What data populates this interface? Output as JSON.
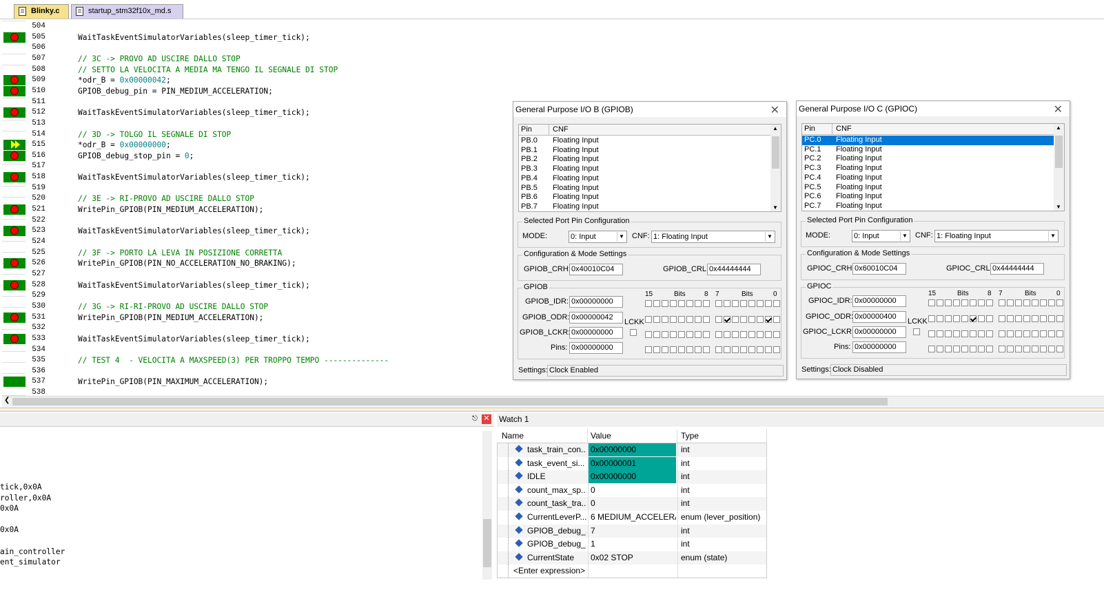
{
  "tabs": [
    {
      "label": "Blinky.c",
      "active": true
    },
    {
      "label": "startup_stm32f10x_md.s",
      "active": false
    }
  ],
  "code_lines": [
    {
      "n": "504",
      "text": "",
      "bp": false,
      "mark": false
    },
    {
      "n": "505",
      "text": "WaitTaskEventSimulatorVariables(sleep_timer_tick);",
      "bp": true,
      "mark": true
    },
    {
      "n": "506",
      "text": "",
      "bp": false,
      "mark": false
    },
    {
      "n": "507",
      "text": "// 3C -> PROVO AD USCIRE DALLO STOP",
      "bp": false,
      "mark": false,
      "comment": true
    },
    {
      "n": "508",
      "text": "// SETTO LA VELOCITA A MEDIA MA TENGO IL SEGNALE DI STOP",
      "bp": false,
      "mark": false,
      "comment": true
    },
    {
      "n": "509",
      "text": "*odr_B = 0x00000042;",
      "bp": true,
      "mark": true
    },
    {
      "n": "510",
      "text": "GPIOB_debug_pin = PIN_MEDIUM_ACCELERATION;",
      "bp": true,
      "mark": true
    },
    {
      "n": "511",
      "text": "",
      "bp": false,
      "mark": false
    },
    {
      "n": "512",
      "text": "WaitTaskEventSimulatorVariables(sleep_timer_tick);",
      "bp": true,
      "mark": true
    },
    {
      "n": "513",
      "text": "",
      "bp": false,
      "mark": false
    },
    {
      "n": "514",
      "text": "// 3D -> TOLGO IL SEGNALE DI STOP",
      "bp": false,
      "mark": false,
      "comment": true
    },
    {
      "n": "515",
      "text": "*odr_B = 0x00000000;",
      "bp": false,
      "mark": true,
      "current": true
    },
    {
      "n": "516",
      "text": "GPIOB_debug_stop_pin = 0;",
      "bp": true,
      "mark": true
    },
    {
      "n": "517",
      "text": "",
      "bp": false,
      "mark": false
    },
    {
      "n": "518",
      "text": "WaitTaskEventSimulatorVariables(sleep_timer_tick);",
      "bp": true,
      "mark": true
    },
    {
      "n": "519",
      "text": "",
      "bp": false,
      "mark": false
    },
    {
      "n": "520",
      "text": "// 3E -> RI-PROVO AD USCIRE DALLO STOP",
      "bp": false,
      "mark": false,
      "comment": true
    },
    {
      "n": "521",
      "text": "WritePin_GPIOB(PIN_MEDIUM_ACCELERATION);",
      "bp": true,
      "mark": true
    },
    {
      "n": "522",
      "text": "",
      "bp": false,
      "mark": false
    },
    {
      "n": "523",
      "text": "WaitTaskEventSimulatorVariables(sleep_timer_tick);",
      "bp": true,
      "mark": true
    },
    {
      "n": "524",
      "text": "",
      "bp": false,
      "mark": false
    },
    {
      "n": "525",
      "text": "// 3F -> PORTO LA LEVA IN POSIZIONE CORRETTA",
      "bp": false,
      "mark": false,
      "comment": true
    },
    {
      "n": "526",
      "text": "WritePin_GPIOB(PIN_NO_ACCELERATION_NO_BRAKING);",
      "bp": true,
      "mark": true
    },
    {
      "n": "527",
      "text": "",
      "bp": false,
      "mark": false
    },
    {
      "n": "528",
      "text": "WaitTaskEventSimulatorVariables(sleep_timer_tick);",
      "bp": true,
      "mark": true
    },
    {
      "n": "529",
      "text": "",
      "bp": false,
      "mark": false
    },
    {
      "n": "530",
      "text": "// 3G -> RI-RI-PROVO AD USCIRE DALLO STOP",
      "bp": false,
      "mark": false,
      "comment": true
    },
    {
      "n": "531",
      "text": "WritePin_GPIOB(PIN_MEDIUM_ACCELERATION);",
      "bp": true,
      "mark": true
    },
    {
      "n": "532",
      "text": "",
      "bp": false,
      "mark": false
    },
    {
      "n": "533",
      "text": "WaitTaskEventSimulatorVariables(sleep_timer_tick);",
      "bp": true,
      "mark": true
    },
    {
      "n": "534",
      "text": "",
      "bp": false,
      "mark": false
    },
    {
      "n": "535",
      "text": "// TEST 4  - VELOCITA A MAXSPEED(3) PER TROPPO TEMPO --------------",
      "bp": false,
      "mark": false,
      "comment": true
    },
    {
      "n": "536",
      "text": "",
      "bp": false,
      "mark": false
    },
    {
      "n": "537",
      "text": "WritePin_GPIOB(PIN_MAXIMUM_ACCELERATION);",
      "bp": false,
      "mark": true
    },
    {
      "n": "538",
      "text": "",
      "bp": false,
      "mark": false
    }
  ],
  "output_lines": [
    "tick,0x0A",
    "roller,0x0A",
    "0x0A",
    "",
    "0x0A",
    "",
    "ain_controller",
    "ent_simulator"
  ],
  "watch": {
    "title": "Watch 1",
    "headers": {
      "name": "Name",
      "value": "Value",
      "type": "Type"
    },
    "rows": [
      {
        "name": "task_train_con...",
        "value": "0x00000000",
        "type": "int",
        "hl": true
      },
      {
        "name": "task_event_si...",
        "value": "0x00000001",
        "type": "int",
        "hl": true
      },
      {
        "name": "IDLE",
        "value": "0x00000000",
        "type": "int",
        "hl": true
      },
      {
        "name": "count_max_sp...",
        "value": "0",
        "type": "int",
        "hl": false
      },
      {
        "name": "count_task_tra...",
        "value": "0",
        "type": "int",
        "hl": false
      },
      {
        "name": "CurrentLeverP...",
        "value": "6 MEDIUM_ACCELERA...",
        "type": "enum (lever_position)",
        "hl": false
      },
      {
        "name": "GPIOB_debug_...",
        "value": "7",
        "type": "int",
        "hl": false
      },
      {
        "name": "GPIOB_debug_...",
        "value": "1",
        "type": "int",
        "hl": false
      },
      {
        "name": "CurrentState",
        "value": "0x02 STOP",
        "type": "enum (state)",
        "hl": false
      }
    ],
    "enter_expression": "<Enter expression>"
  },
  "gpiob": {
    "title": "General Purpose I/O B (GPIOB)",
    "col_pin": "Pin",
    "col_cnf": "CNF",
    "pins": [
      [
        "PB.0",
        "Floating Input"
      ],
      [
        "PB.1",
        "Floating Input"
      ],
      [
        "PB.2",
        "Floating Input"
      ],
      [
        "PB.3",
        "Floating Input"
      ],
      [
        "PB.4",
        "Floating Input"
      ],
      [
        "PB.5",
        "Floating Input"
      ],
      [
        "PB.6",
        "Floating Input"
      ],
      [
        "PB.7",
        "Floating Input"
      ]
    ],
    "selected_group": "Selected Port Pin Configuration",
    "mode_label": "MODE:",
    "mode_value": "0: Input",
    "cnf_label": "CNF:",
    "cnf_value": "1: Floating Input",
    "cfg_group": "Configuration & Mode Settings",
    "crh_label": "GPIOB_CRH:",
    "crh_value": "0x40010C04",
    "crl_label": "GPIOB_CRL:",
    "crl_value": "0x44444444",
    "port_group": "GPIOB",
    "bits_hi": "15",
    "bits_lbl": "Bits",
    "bits_8": "8",
    "bits_7": "7",
    "bits_0": "0",
    "idr_label": "GPIOB_IDR:",
    "idr_value": "0x00000000",
    "odr_label": "GPIOB_ODR:",
    "odr_value": "0x00000042",
    "lckr_label": "GPIOB_LCKR:",
    "lckr_value": "0x00000000",
    "lckk_label": "LCKK",
    "pins_label": "Pins:",
    "pins_value": "0x00000000",
    "settings_label": "Settings:",
    "settings_value": "Clock Enabled",
    "odr_checked_bits": [
      1,
      6
    ]
  },
  "gpioc": {
    "title": "General Purpose I/O C (GPIOC)",
    "col_pin": "Pin",
    "col_cnf": "CNF",
    "pins": [
      [
        "PC.0",
        "Floating Input"
      ],
      [
        "PC.1",
        "Floating Input"
      ],
      [
        "PC.2",
        "Floating Input"
      ],
      [
        "PC.3",
        "Floating Input"
      ],
      [
        "PC.4",
        "Floating Input"
      ],
      [
        "PC.5",
        "Floating Input"
      ],
      [
        "PC.6",
        "Floating Input"
      ],
      [
        "PC.7",
        "Floating Input"
      ]
    ],
    "selected_group": "Selected Port Pin Configuration",
    "mode_label": "MODE:",
    "mode_value": "0: Input",
    "cnf_label": "CNF:",
    "cnf_value": "1: Floating Input",
    "cfg_group": "Configuration & Mode Settings",
    "crh_label": "GPIOC_CRH:",
    "crh_value": "0x60010C04",
    "crl_label": "GPIOC_CRL:",
    "crl_value": "0x44444444",
    "port_group": "GPIOC",
    "bits_hi": "15",
    "bits_lbl": "Bits",
    "bits_8": "8",
    "bits_7": "7",
    "bits_0": "0",
    "idr_label": "GPIOC_IDR:",
    "idr_value": "0x00000000",
    "odr_label": "GPIOC_ODR:",
    "odr_value": "0x00000400",
    "lckr_label": "GPIOC_LCKR:",
    "lckr_value": "0x00000000",
    "lckk_label": "LCKK",
    "pins_label": "Pins:",
    "pins_value": "0x00000000",
    "settings_label": "Settings:",
    "settings_value": "Clock Disabled",
    "odr_checked_bits": [
      10
    ]
  },
  "colors": {
    "breakpoint_bar": "#008a00",
    "breakpoint_dot": "#ff0000",
    "watch_highlight": "#00a597",
    "comment": "#008000",
    "selection": "#0078d7"
  }
}
